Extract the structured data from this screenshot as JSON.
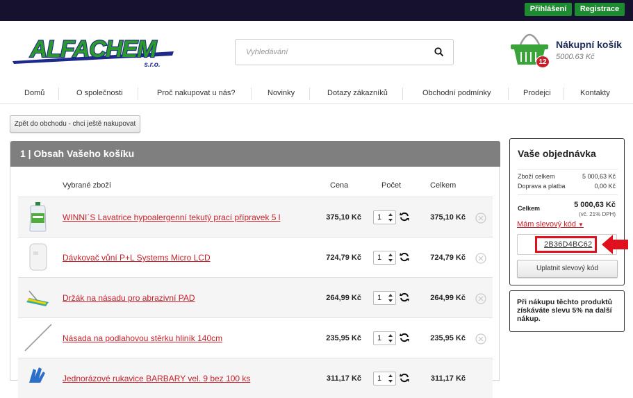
{
  "topbar": {
    "login_label": "Přihlášení",
    "register_label": "Registrace"
  },
  "brand": {
    "logo_text": "ALFACHEM",
    "logo_sub": "s.r.o.",
    "green": "#1d8b2f",
    "navy": "#1e2a8a",
    "red": "#c8202a"
  },
  "search": {
    "placeholder": "Vyhledávání",
    "icon": "search-icon"
  },
  "cart": {
    "title": "Nákupní košík",
    "sum": "5000.63 Kč",
    "count": "12",
    "icon": "basket-icon"
  },
  "nav": [
    {
      "label": "Domů"
    },
    {
      "label": "O společnosti"
    },
    {
      "label": "Proč nakupovat u nás?"
    },
    {
      "label": "Novinky"
    },
    {
      "label": "Dotazy zákazníků"
    },
    {
      "label": "Obchodní podmínky"
    },
    {
      "label": "Prodejci"
    },
    {
      "label": "Kontakty"
    }
  ],
  "back_label": "Zpět do obchodu - chci ještě nakupovat",
  "cart_panel": {
    "title": "1 | Obsah Vašeho košíku",
    "columns": {
      "item": "Vybrané zboží",
      "price": "Cena",
      "qty": "Počet",
      "total": "Celkem"
    },
    "rows": [
      {
        "name": "WINNI´S Lavatrice hypoalergenní tekutý prací přípravek 5 l",
        "price": "375,10 Kč",
        "qty": "1",
        "total": "375,10 Kč",
        "thumb": "detergent-bottle-icon"
      },
      {
        "name": "Dávkovač vůní P+L Systems Micro LCD",
        "price": "724,79 Kč",
        "qty": "1",
        "total": "724,79 Kč",
        "thumb": "dispenser-icon"
      },
      {
        "name": "Držák na násadu pro abrazivní PAD",
        "price": "264,99 Kč",
        "qty": "1",
        "total": "264,99 Kč",
        "thumb": "pad-holder-icon"
      },
      {
        "name": "Násada na podlahovou stěrku hliník 140cm",
        "price": "235,95 Kč",
        "qty": "1",
        "total": "235,95 Kč",
        "thumb": "handle-icon"
      },
      {
        "name": "Jednorázové rukavice BARBARY vel. 9 bez 100 ks",
        "price": "311,17 Kč",
        "qty": "1",
        "total": "311,17 Kč",
        "thumb": "gloves-icon"
      }
    ]
  },
  "order": {
    "title": "Vaše objednávka",
    "goods_label": "Zboží celkem",
    "goods_value": "5 000,63 Kč",
    "shipping_label": "Doprava a platba",
    "shipping_value": "0,00 Kč",
    "total_label": "Celkem",
    "total_value": "5 000,63 Kč",
    "vat_note": "(vč. 21% DPH)",
    "discount_link": "Mám slevový kód",
    "discount_code": "2B36D4BC62",
    "apply_label": "Uplatnit slevový kód"
  },
  "promo": {
    "text": "Při nákupu těchto produktů získáváte slevu 5% na další nákup."
  }
}
